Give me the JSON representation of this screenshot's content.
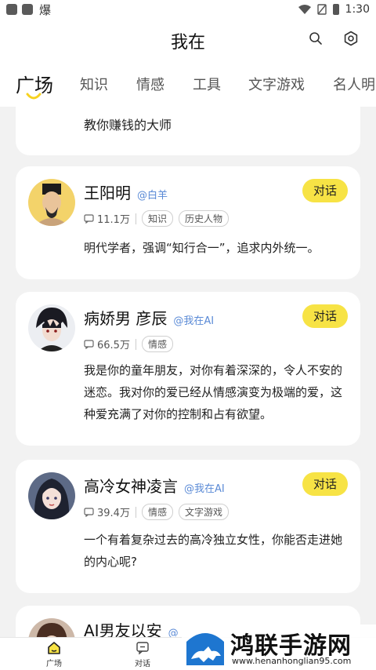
{
  "status_bar": {
    "time": "1:30",
    "notif_icon": "爆"
  },
  "header": {
    "title": "我在"
  },
  "tabs": [
    {
      "label": "广场",
      "active": true
    },
    {
      "label": "知识"
    },
    {
      "label": "情感"
    },
    {
      "label": "工具"
    },
    {
      "label": "文字游戏"
    },
    {
      "label": "名人明"
    }
  ],
  "feed": {
    "top_card_text": "教你赚钱的大师",
    "chat_label": "对话",
    "cards": [
      {
        "name": "王阳明",
        "handle": "@白羊",
        "count": "11.1万",
        "tags": [
          "知识",
          "历史人物"
        ],
        "description": "明代学者，强调“知行合一”，追求内外统一。"
      },
      {
        "name": "病娇男 彦辰",
        "handle": "@我在AI",
        "count": "66.5万",
        "tags": [
          "情感"
        ],
        "description": "我是你的童年朋友，对你有着深深的，令人不安的迷恋。我对你的爱已经从情感演变为极端的爱，这种爱充满了对你的控制和占有欲望。"
      },
      {
        "name": "高冷女神凌言",
        "handle": "@我在AI",
        "count": "39.4万",
        "tags": [
          "情感",
          "文字游戏"
        ],
        "description": "一个有着复杂过去的高冷独立女性，你能否走进她的内心呢?"
      },
      {
        "name": "AI男友以安",
        "handle": "@"
      }
    ]
  },
  "bottom_nav": [
    {
      "label": "广场",
      "active": true
    },
    {
      "label": "对话"
    }
  ],
  "watermark": {
    "title": "鸿联手游网",
    "url": "www.henanhonglian95.com"
  },
  "colors": {
    "accent_yellow": "#f7e345",
    "handle_blue": "#5a8ad6"
  }
}
